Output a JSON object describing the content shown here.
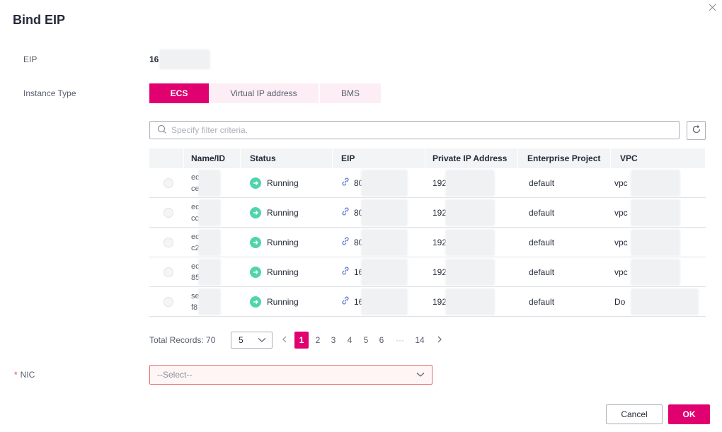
{
  "dialog": {
    "title": "Bind EIP",
    "close_icon": "close-icon"
  },
  "eip": {
    "label": "EIP",
    "value": "16"
  },
  "instance_type": {
    "label": "Instance Type",
    "options": [
      "ECS",
      "Virtual IP address",
      "BMS"
    ],
    "selected": "ECS"
  },
  "search": {
    "placeholder": "Specify filter criteria.",
    "icon": "search-icon",
    "refresh_icon": "refresh-icon"
  },
  "table": {
    "headers": [
      "",
      "Name/ID",
      "Status",
      "EIP",
      "Private IP Address",
      "Enterprise Project",
      "VPC"
    ],
    "rows": [
      {
        "name": "ec",
        "id": "ce",
        "status": "Running",
        "eip": "80",
        "private_ip": "192",
        "project": "default",
        "vpc": "vpc"
      },
      {
        "name": "ec",
        "id": "cc",
        "status": "Running",
        "eip": "80",
        "private_ip": "192",
        "project": "default",
        "vpc": "vpc"
      },
      {
        "name": "ec",
        "id": "c2",
        "status": "Running",
        "eip": "80",
        "private_ip": "192",
        "project": "default",
        "vpc": "vpc"
      },
      {
        "name": "ec",
        "id": "85",
        "status": "Running",
        "eip": "16",
        "private_ip": "192",
        "project": "default",
        "vpc": "vpc"
      },
      {
        "name": "se",
        "id": "f8",
        "status": "Running",
        "eip": "16",
        "private_ip": "192",
        "project": "default",
        "vpc": "Do"
      }
    ],
    "status_color": "#50d4ab",
    "link_color": "#526ecc"
  },
  "pagination": {
    "total_label": "Total Records: 70",
    "page_size": "5",
    "pages": [
      "1",
      "2",
      "3",
      "4",
      "5",
      "6",
      "···",
      "14"
    ],
    "current": "1"
  },
  "nic": {
    "label": "NIC",
    "required_mark": "*",
    "placeholder": "--Select--"
  },
  "footer": {
    "cancel_label": "Cancel",
    "ok_label": "OK"
  },
  "colors": {
    "accent": "#e0006f",
    "accent_light": "#fdeef5",
    "error_border": "#e46a6a"
  }
}
